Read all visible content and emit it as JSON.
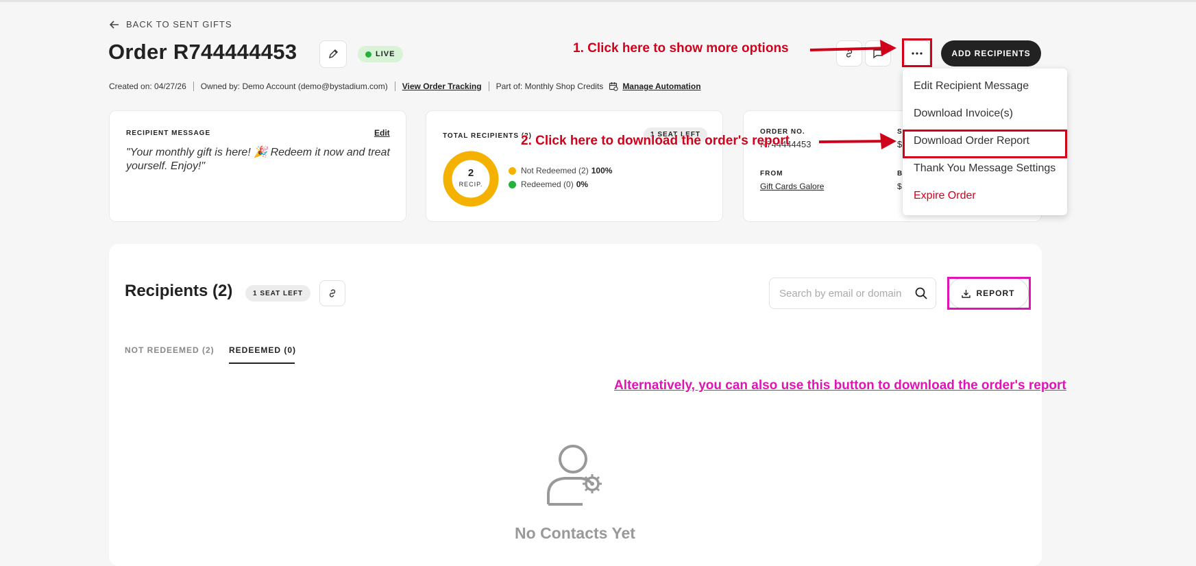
{
  "header": {
    "back_label": "BACK TO SENT GIFTS",
    "order_title": "Order R744444453",
    "status_badge": "LIVE",
    "add_recipients_label": "ADD RECIPIENTS"
  },
  "meta": {
    "created": "Created on: 04/27/26",
    "owner": "Owned by: Demo Account (demo@bystadium.com)",
    "tracking_link": "View Order Tracking",
    "part_of": "Part of: Monthly Shop Credits",
    "automation_link": "Manage Automation"
  },
  "more_menu": {
    "items": [
      {
        "label": "Edit Recipient Message",
        "color": "#333333"
      },
      {
        "label": "Download Invoice(s)",
        "color": "#333333"
      },
      {
        "label": "Download Order Report",
        "color": "#333333"
      },
      {
        "label": "Thank You Message Settings",
        "color": "#333333"
      },
      {
        "label": "Expire Order",
        "color": "#d0021b"
      }
    ]
  },
  "message_card": {
    "heading": "RECIPIENT MESSAGE",
    "edit_label": "Edit",
    "text": "\"Your monthly gift is here! 🎉 Redeem it now and treat yourself. Enjoy!\""
  },
  "recipients_card": {
    "heading": "TOTAL RECIPIENTS (2)",
    "seat_badge": "1 SEAT LEFT",
    "donut_count": "2",
    "donut_label": "RECIP.",
    "legend": [
      {
        "label": "Not Redeemed (2)",
        "pct": "100%",
        "color": "#f5b100",
        "fraction": 1.0
      },
      {
        "label": "Redeemed (0)",
        "pct": "0%",
        "color": "#23b33a",
        "fraction": 0.0
      }
    ]
  },
  "order_card": {
    "order_no_label": "ORDER NO.",
    "order_no_value": "R744444453",
    "from_label": "FROM",
    "from_value": "Gift Cards Galore",
    "col2_label": "S",
    "col2_value": "$",
    "col3_label": "B",
    "col3_value": "$"
  },
  "annotations": {
    "step1": "1. Click here to show more options",
    "step2": "2. Click here to download the order's report",
    "alternative": "Alternatively, you can also use this button to download the order's report"
  },
  "recipients_section": {
    "title": "Recipients (2)",
    "seat_badge": "1 SEAT LEFT",
    "search_placeholder": "Search by email or domain",
    "report_label": "REPORT",
    "tabs": [
      {
        "label": "NOT REDEEMED (2)",
        "active": false
      },
      {
        "label": "REDEEMED (0)",
        "active": true
      }
    ],
    "empty_text": "No Contacts Yet"
  },
  "colors": {
    "annotation_red": "#d0021b",
    "annotation_magenta": "#e014b4",
    "live_green": "#23b33a",
    "donut_yellow": "#f5b100"
  }
}
